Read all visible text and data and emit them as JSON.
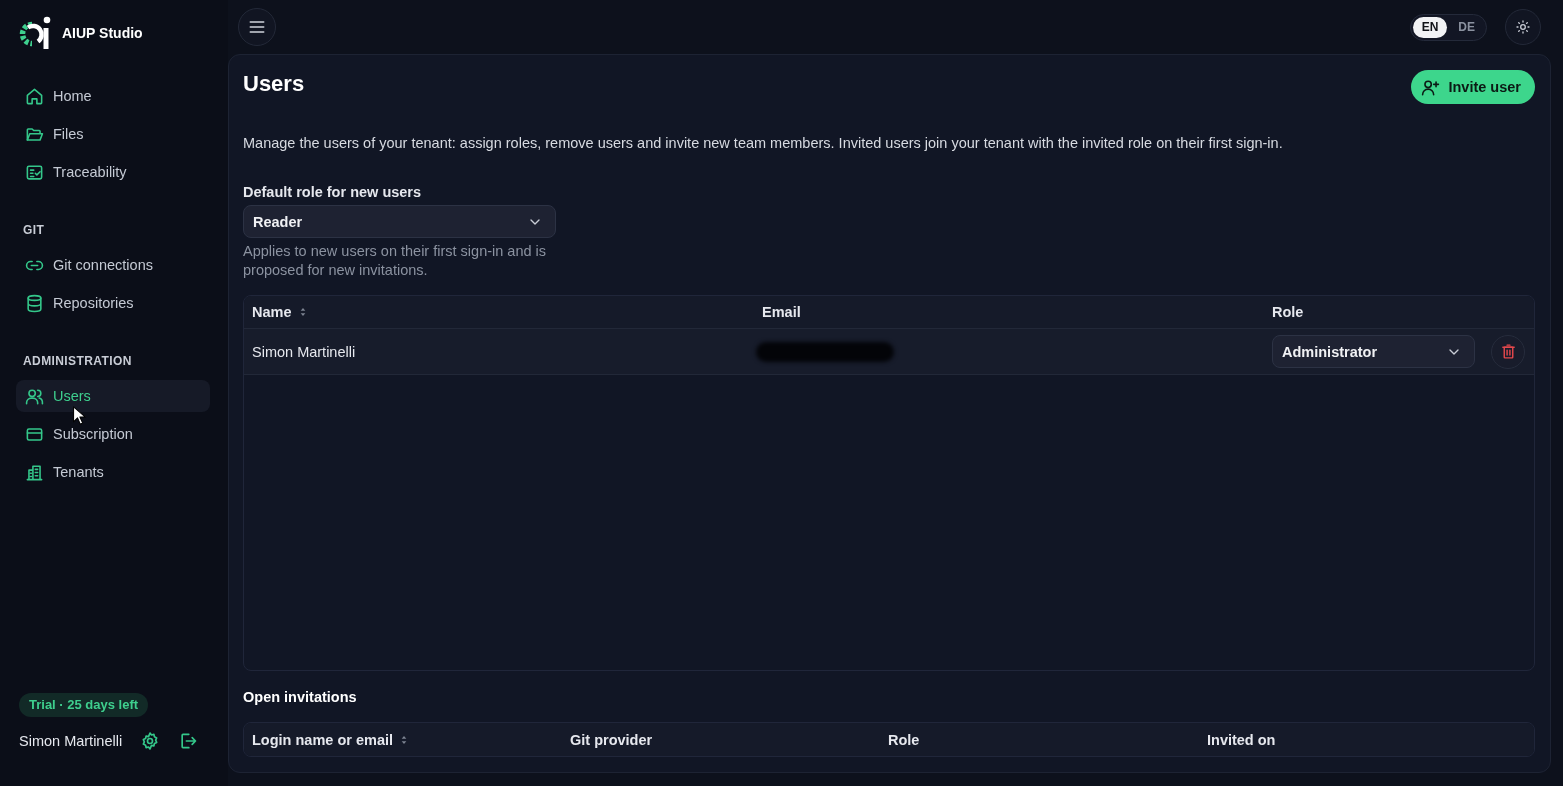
{
  "sidebar": {
    "brand": "AIUP Studio",
    "sections": [
      {
        "items": [
          {
            "label": "Home",
            "selected": false
          },
          {
            "label": "Files",
            "selected": false
          },
          {
            "label": "Traceability",
            "selected": false
          }
        ]
      },
      {
        "title": "GIT",
        "items": [
          {
            "label": "Git connections",
            "selected": false
          },
          {
            "label": "Repositories",
            "selected": false
          }
        ]
      },
      {
        "title": "ADMINISTRATION",
        "items": [
          {
            "label": "Users",
            "selected": true
          },
          {
            "label": "Subscription",
            "selected": false
          },
          {
            "label": "Tenants",
            "selected": false
          }
        ]
      }
    ],
    "trial_badge": "Trial · 25 days left",
    "user_name": "Simon Martinelli"
  },
  "topbar": {
    "languages": [
      {
        "label": "EN",
        "selected": true
      },
      {
        "label": "DE",
        "selected": false
      }
    ]
  },
  "page": {
    "title": "Users",
    "invite_button": "Invite user",
    "description": "Manage the users of your tenant: assign roles, remove users and invite new team members. Invited users join your tenant with the invited role on their first sign-in.",
    "default_role": {
      "label": "Default role for new users",
      "value": "Reader",
      "hint": "Applies to new users on their first sign-in and is proposed for new invitations."
    },
    "users_table": {
      "columns": [
        {
          "label": "Name",
          "sortable": true
        },
        {
          "label": "Email",
          "sortable": false
        },
        {
          "label": "Role",
          "sortable": false
        }
      ],
      "rows": [
        {
          "name": "Simon Martinelli",
          "email_redacted": true,
          "role": "Administrator"
        }
      ]
    },
    "invitations": {
      "title": "Open invitations",
      "columns": [
        {
          "label": "Login name or email",
          "sortable": true
        },
        {
          "label": "Git provider",
          "sortable": false
        },
        {
          "label": "Role",
          "sortable": false
        },
        {
          "label": "Invited on",
          "sortable": false
        }
      ]
    }
  }
}
